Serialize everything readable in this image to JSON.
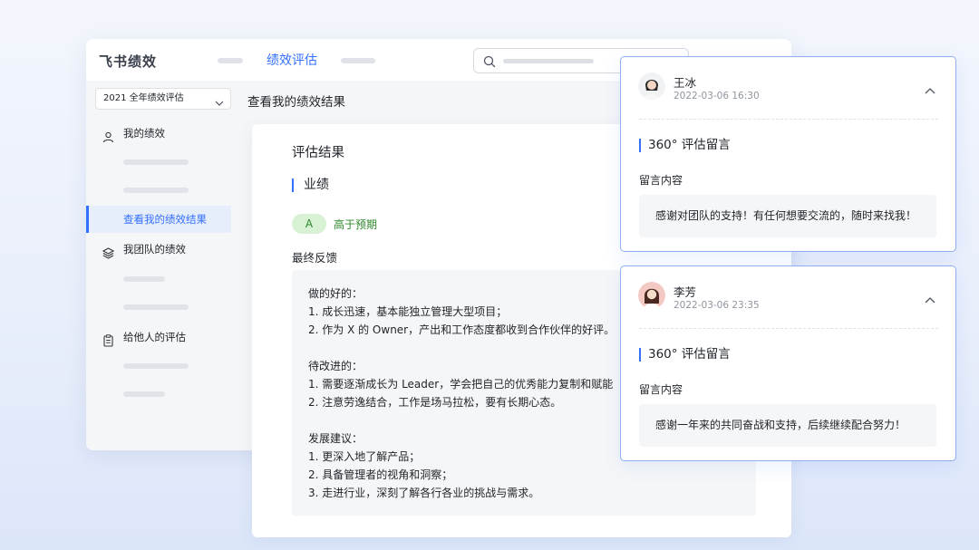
{
  "app": {
    "logo": "飞书绩效",
    "nav_active": "绩效评估"
  },
  "sidebar": {
    "cycle_select": "2021 全年绩效评估",
    "items": [
      {
        "label": "我的绩效",
        "icon": "user-icon"
      },
      {
        "label": "我团队的绩效",
        "icon": "layers-icon"
      },
      {
        "label": "给他人的评估",
        "icon": "clipboard-icon"
      }
    ],
    "active_sub": "查看我的绩效结果"
  },
  "main": {
    "title": "查看我的绩效结果",
    "card": {
      "heading": "评估结果",
      "section": "业绩",
      "grade": "A",
      "grade_text": "高于预期",
      "feedback_label": "最终反馈",
      "feedback_lines": [
        "做的好的：",
        "1. 成长迅速，基本能独立管理大型项目；",
        "2. 作为 X 的 Owner，产出和工作态度都收到合作伙伴的好评。",
        "",
        "待改进的：",
        "1. 需要逐渐成长为 Leader，学会把自己的优秀能力复制和赋能",
        "2. 注意劳逸结合，工作是场马拉松，要有长期心态。",
        "",
        "发展建议：",
        "1. 更深入地了解产品；",
        "2. 具备管理者的视角和洞察；",
        "3. 走进行业，深刻了解各行各业的挑战与需求。"
      ]
    }
  },
  "comments": [
    {
      "name": "王冰",
      "time": "2022-03-06 16:30",
      "section": "360° 评估留言",
      "label": "留言内容",
      "message": "感谢对团队的支持！有任何想要交流的，随时来找我！"
    },
    {
      "name": "李芳",
      "time": "2022-03-06 23:35",
      "section": "360° 评估留言",
      "label": "留言内容",
      "message": "感谢一年来的共同奋战和支持，后续继续配合努力！"
    }
  ],
  "colors": {
    "accent": "#3370ff",
    "success": "#2c8a2a",
    "badge_bg": "#d8f1d4"
  }
}
